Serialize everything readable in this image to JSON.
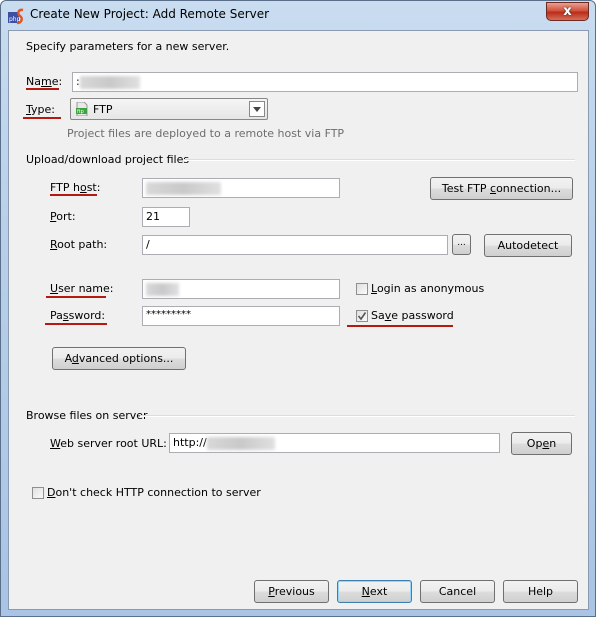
{
  "window": {
    "title": "Create New Project: Add Remote Server",
    "close_label": "x"
  },
  "intro": "Specify parameters for a new server.",
  "name_field": {
    "label_pre": "Na",
    "label_u": "m",
    "label_post": "e:",
    "value": ":"
  },
  "type_field": {
    "label_u": "T",
    "label_post": "ype:",
    "icon_text": "ftp",
    "value": "FTP",
    "hint": "Project files are deployed to a remote host via FTP"
  },
  "upload_section": {
    "title": "Upload/download project files"
  },
  "ftp_host": {
    "label_pre": "FTP h",
    "label_u": "o",
    "label_post": "st:",
    "value": ""
  },
  "test_button": {
    "pre": "Test FTP ",
    "u": "c",
    "post": "onnection..."
  },
  "port": {
    "label_u": "P",
    "label_post": "ort:",
    "value": "21"
  },
  "root_path": {
    "label_u": "R",
    "label_post": "oot path:",
    "value": "/",
    "browse_label": "...",
    "autodetect_label": "Autodetect"
  },
  "user_name": {
    "label_u": "U",
    "label_post": "ser name:",
    "value": ""
  },
  "login_anonymous": {
    "label_u": "L",
    "label_post": "ogin as anonymous",
    "checked": false
  },
  "password": {
    "label_pre": "Pa",
    "label_u": "s",
    "label_post": "sword:",
    "value": "*********"
  },
  "save_password": {
    "label_pre": "Sa",
    "label_u": "v",
    "label_post": "e password",
    "checked": true
  },
  "advanced_button": {
    "pre": "A",
    "u": "d",
    "post": "vanced options..."
  },
  "browse_section": {
    "title": "Browse files on server"
  },
  "web_url": {
    "label_u": "W",
    "label_post": "eb server root URL:",
    "value": "http://",
    "open_pre": "Op",
    "open_u": "e",
    "open_post": "n"
  },
  "dont_check": {
    "label_u": "D",
    "label_post": "on't check HTTP connection to server",
    "checked": false
  },
  "footer": {
    "previous_u": "P",
    "previous_post": "revious",
    "next_u": "N",
    "next_post": "ext",
    "cancel": "Cancel",
    "help": "Help"
  },
  "colors": {
    "annotation_red": "#b51a12",
    "dialog_bg": "#f0f0f0",
    "icon_green": "#3aa53a"
  }
}
